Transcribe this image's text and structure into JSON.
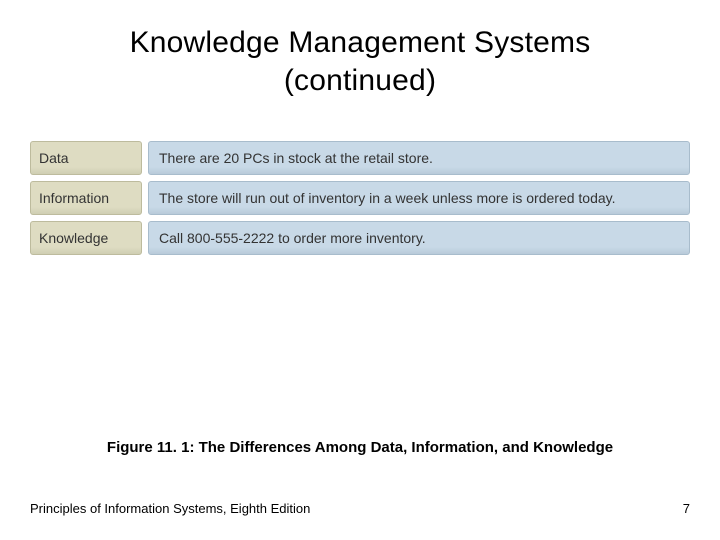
{
  "title_line1": "Knowledge Management Systems",
  "title_line2": "(continued)",
  "rows": [
    {
      "label": "Data",
      "value": "There are 20 PCs in stock at the retail store."
    },
    {
      "label": "Information",
      "value": "The store will run out of inventory in a week unless more is ordered today."
    },
    {
      "label": "Knowledge",
      "value": "Call 800-555-2222 to order more inventory."
    }
  ],
  "caption": "Figure 11. 1: The Differences Among Data, Information, and Knowledge",
  "footer_left": "Principles of Information Systems, Eighth Edition",
  "footer_right": "7"
}
